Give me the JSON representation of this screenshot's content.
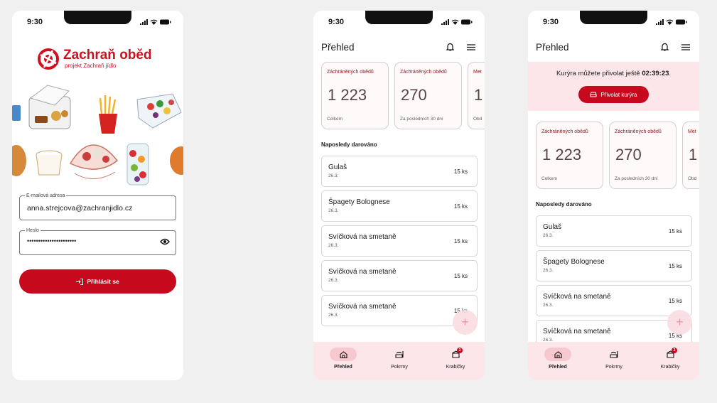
{
  "status": {
    "time": "9:30"
  },
  "login": {
    "brand_name": "Zachraň oběd",
    "brand_subtitle": "projekt Zachraň jídlo",
    "email_label": "E-mailová adresa",
    "email_value": "anna.strejcova@zachranjidlo.cz",
    "password_label": "Heslo",
    "password_masked": "••••••••••••••••••••••",
    "login_button": "Přihlásit se"
  },
  "dashboard": {
    "title": "Přehled",
    "stats": [
      {
        "label": "Záchráněných obědů",
        "value": "1 223",
        "sub": "Celkem"
      },
      {
        "label": "Záchráněných obědů",
        "value": "270",
        "sub": "Za posledních 30 dní"
      },
      {
        "label": "Met",
        "value": "1",
        "sub": "Obd"
      }
    ],
    "recent_title": "Naposledy darováno",
    "items": [
      {
        "name": "Gulaš",
        "date": "26.3.",
        "qty": "15 ks"
      },
      {
        "name": "Špagety Bolognese",
        "date": "26.3.",
        "qty": "15 ks"
      },
      {
        "name": "Svíčková na smetaně",
        "date": "26.3.",
        "qty": "15 ks"
      },
      {
        "name": "Svíčková na smetaně",
        "date": "26.3.",
        "qty": "15 ks"
      },
      {
        "name": "Svíčková na smetaně",
        "date": "26.3.",
        "qty": "15 ks"
      }
    ],
    "fab": "+",
    "nav": [
      {
        "label": "Přehled",
        "icon": "home-icon"
      },
      {
        "label": "Pokrmy",
        "icon": "food-icon"
      },
      {
        "label": "Krabičky",
        "icon": "box-icon",
        "badge": "3"
      }
    ]
  },
  "courier": {
    "text_prefix": "Kurýra můžete přivolat ještě",
    "countdown": "02:39:23",
    "text_suffix": ".",
    "button": "Přivolat kurýra"
  },
  "colors": {
    "brand_red": "#c7091d",
    "nav_bg": "#fce6ea"
  }
}
